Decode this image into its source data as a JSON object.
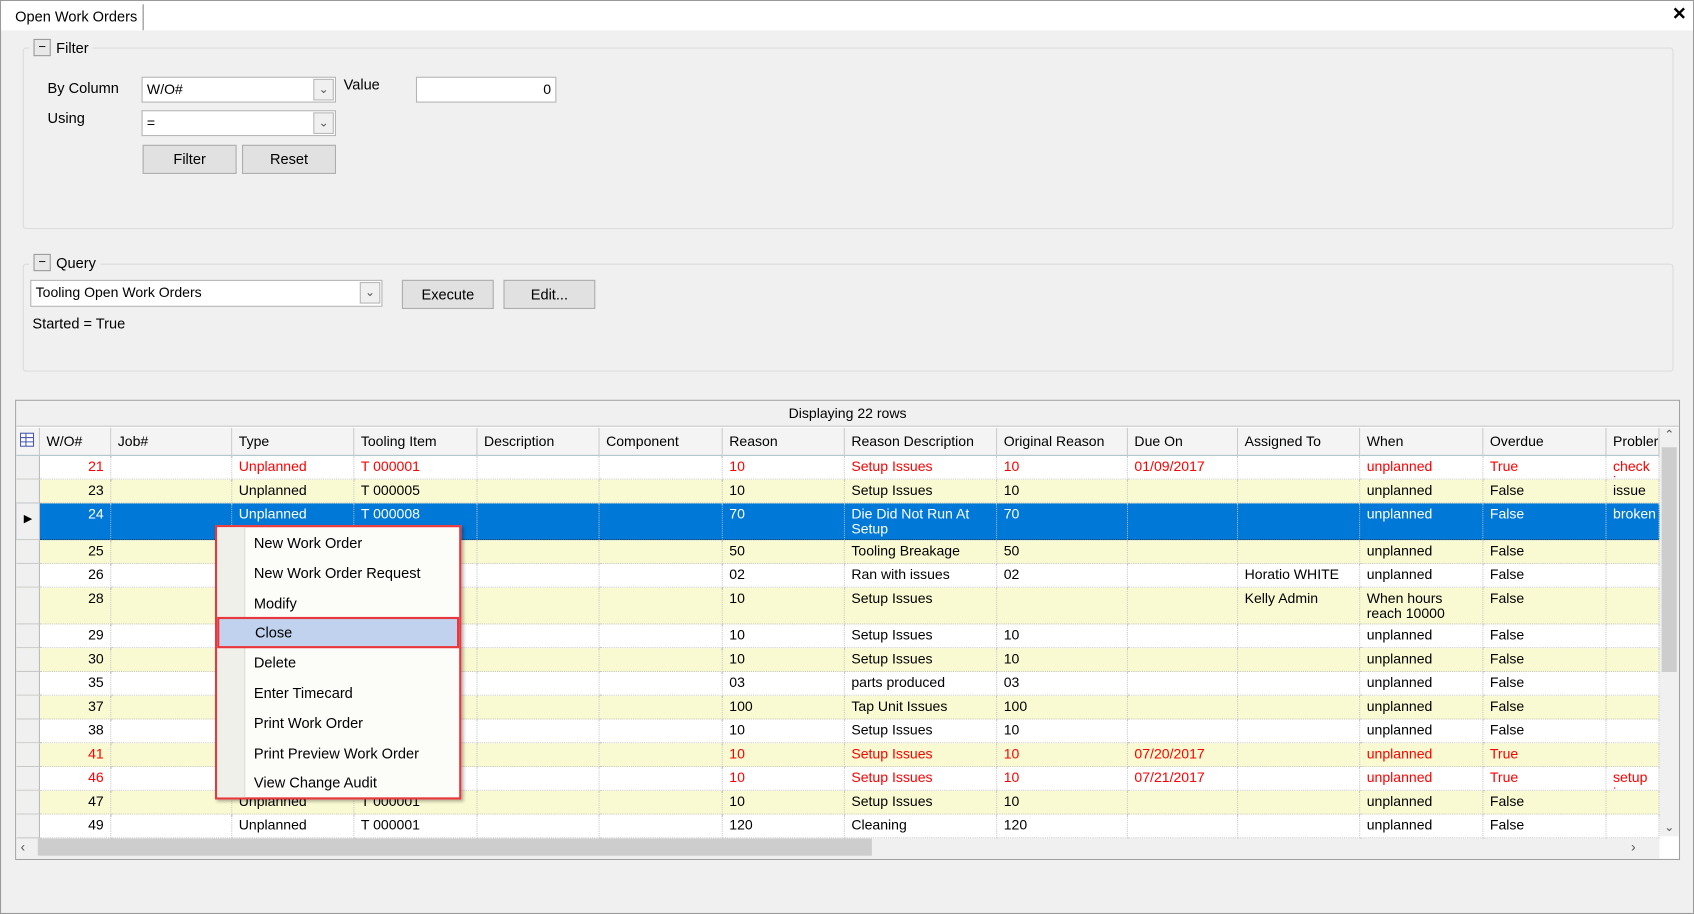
{
  "window": {
    "tab": "Open Work Orders",
    "close": "✕"
  },
  "filter": {
    "title": "Filter",
    "collapse": "−",
    "by_column_label": "By Column",
    "by_column_value": "W/O#",
    "using_label": "Using",
    "using_value": "=",
    "value_label": "Value",
    "value": "0",
    "filter_button": "Filter",
    "reset_button": "Reset"
  },
  "query": {
    "title": "Query",
    "collapse": "−",
    "selected": "Tooling Open Work Orders",
    "execute_button": "Execute",
    "edit_button": "Edit...",
    "criteria": "Started = True"
  },
  "grid": {
    "caption": "Displaying 22 rows",
    "columns": [
      "W/O#",
      "Job#",
      "Type",
      "Tooling Item",
      "Description",
      "Component",
      "Reason",
      "Reason Description",
      "Original Reason",
      "Due On",
      "Assigned To",
      "When",
      "Overdue",
      "Probler"
    ],
    "rows": [
      {
        "cells": [
          "21",
          "",
          "Unplanned",
          "T 000001",
          "",
          "",
          "10",
          "Setup Issues",
          "10",
          "01/09/2017",
          "",
          "unplanned",
          "True",
          "check i"
        ],
        "overdue": true
      },
      {
        "cells": [
          "23",
          "",
          "Unplanned",
          "T 000005",
          "",
          "",
          "10",
          "Setup Issues",
          "10",
          "",
          "",
          "unplanned",
          "False",
          "issue"
        ]
      },
      {
        "cells": [
          "24",
          "",
          "Unplanned",
          "T 000008",
          "",
          "",
          "70",
          "Die Did Not Run At Setup",
          "70",
          "",
          "",
          "unplanned",
          "False",
          "broken"
        ],
        "selected": true,
        "tall": true
      },
      {
        "cells": [
          "25",
          "",
          "",
          "",
          "",
          "",
          "50",
          "Tooling Breakage",
          "50",
          "",
          "",
          "unplanned",
          "False",
          ""
        ]
      },
      {
        "cells": [
          "26",
          "",
          "",
          "",
          "",
          "",
          "02",
          "Ran with issues",
          "02",
          "",
          "Horatio WHITE",
          "unplanned",
          "False",
          ""
        ]
      },
      {
        "cells": [
          "28",
          "",
          "",
          "",
          "",
          "",
          "10",
          "Setup Issues",
          "",
          "",
          "Kelly Admin",
          "When hours reach 10000",
          "False",
          ""
        ],
        "tall": true
      },
      {
        "cells": [
          "29",
          "",
          "",
          "",
          "",
          "",
          "10",
          "Setup Issues",
          "10",
          "",
          "",
          "unplanned",
          "False",
          ""
        ]
      },
      {
        "cells": [
          "30",
          "",
          "",
          "",
          "",
          "",
          "10",
          "Setup Issues",
          "10",
          "",
          "",
          "unplanned",
          "False",
          ""
        ]
      },
      {
        "cells": [
          "35",
          "",
          "",
          "",
          "",
          "",
          "03",
          "parts produced",
          "03",
          "",
          "",
          "unplanned",
          "False",
          ""
        ]
      },
      {
        "cells": [
          "37",
          "",
          "",
          "",
          "",
          "",
          "100",
          "Tap Unit Issues",
          "100",
          "",
          "",
          "unplanned",
          "False",
          ""
        ]
      },
      {
        "cells": [
          "38",
          "",
          "",
          "",
          "",
          "",
          "10",
          "Setup Issues",
          "10",
          "",
          "",
          "unplanned",
          "False",
          ""
        ]
      },
      {
        "cells": [
          "41",
          "",
          "",
          "",
          "",
          "",
          "10",
          "Setup Issues",
          "10",
          "07/20/2017",
          "",
          "unplanned",
          "True",
          ""
        ],
        "overdue": true
      },
      {
        "cells": [
          "46",
          "",
          "",
          "",
          "",
          "",
          "10",
          "Setup Issues",
          "10",
          "07/21/2017",
          "",
          "unplanned",
          "True",
          "setup is"
        ],
        "overdue": true
      },
      {
        "cells": [
          "47",
          "",
          "Unplanned",
          "T 000001",
          "",
          "",
          "10",
          "Setup Issues",
          "10",
          "",
          "",
          "unplanned",
          "False",
          ""
        ]
      },
      {
        "cells": [
          "49",
          "",
          "Unplanned",
          "T 000001",
          "",
          "",
          "120",
          "Cleaning",
          "120",
          "",
          "",
          "unplanned",
          "False",
          ""
        ]
      }
    ]
  },
  "context_menu": {
    "items": [
      "New Work Order",
      "New Work Order Request",
      "Modify",
      "Close",
      "Delete",
      "Enter Timecard",
      "Print Work Order",
      "Print Preview Work Order",
      "View Change Audit"
    ],
    "highlighted_index": 3
  },
  "colors": {
    "selected_row": "#0078d7",
    "alt_row": "#fafad2",
    "overdue_text": "#ff0000",
    "callout": "#e8383d"
  }
}
